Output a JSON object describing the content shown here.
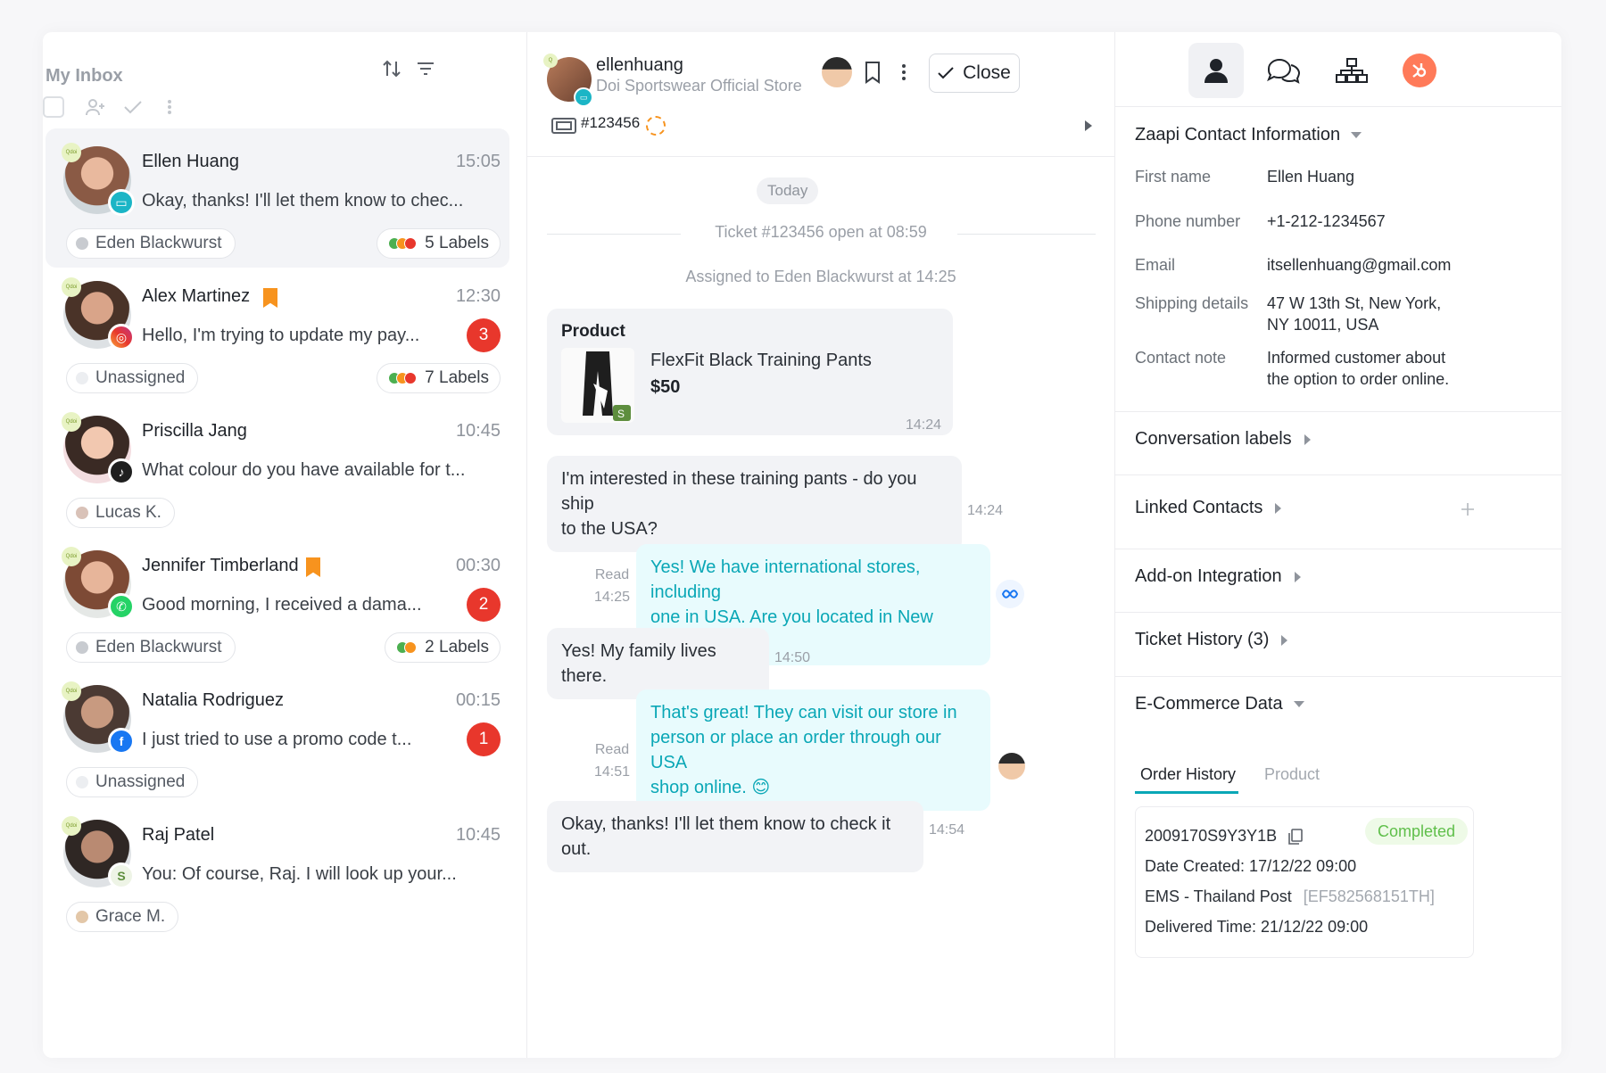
{
  "inbox": {
    "title": "My Inbox",
    "conversations": [
      {
        "name": "Ellen Huang",
        "time": "15:05",
        "message": "Okay, thanks! I'll let them know to chec...",
        "assignee": "Eden Blackwurst",
        "labels": "5 Labels",
        "channel": "chat",
        "unread": ""
      },
      {
        "name": "Alex Martinez",
        "time": "12:30",
        "message": "Hello, I'm trying to update my pay...",
        "assignee": "Unassigned",
        "labels": "7 Labels",
        "channel": "instagram",
        "unread": "3"
      },
      {
        "name": "Priscilla Jang",
        "time": "10:45",
        "message": "What colour do you have available for t...",
        "assignee": "Lucas K.",
        "labels": "",
        "channel": "tiktok",
        "unread": ""
      },
      {
        "name": "Jennifer Timberland",
        "time": "00:30",
        "message": "Good morning, I received a dama...",
        "assignee": "Eden Blackwurst",
        "labels": "2 Labels",
        "channel": "whatsapp",
        "unread": "2"
      },
      {
        "name": "Natalia Rodriguez",
        "time": "00:15",
        "message": "I just tried to use a promo code t...",
        "assignee": "Unassigned",
        "labels": "",
        "channel": "facebook",
        "unread": "1"
      },
      {
        "name": "Raj Patel",
        "time": "10:45",
        "message": "You: Of course, Raj. I will look up your...",
        "assignee": "Grace M.",
        "labels": "",
        "channel": "shopify",
        "unread": ""
      }
    ]
  },
  "chat": {
    "header": {
      "username": "ellenhuang",
      "store": "Doi Sportswear Official Store",
      "close_label": "Close",
      "ticket": "#123456"
    },
    "day": "Today",
    "system": [
      "Ticket #123456 open at 08:59",
      "Assigned to Eden Blackwurst at 14:25"
    ],
    "product": {
      "title": "Product",
      "name": "FlexFit Black Training Pants",
      "price": "$50",
      "time": "14:24"
    },
    "messages": [
      {
        "text1": "I'm interested in these training pants - do you ship",
        "text2": "to the USA?",
        "time": "14:24"
      },
      {
        "text1": "Yes! We have international stores, including",
        "text2": "one in USA. Are you located in New york?",
        "read": "Read",
        "time": "14:25"
      },
      {
        "text1": "Yes! My family lives there.",
        "time": "14:50"
      },
      {
        "text1": "That's great! They can visit our store in",
        "text2": "person or place an order through our USA",
        "text3": "shop online. 😊",
        "read": "Read",
        "time": "14:51"
      },
      {
        "text1": "Okay, thanks! I'll let them know to check it out.",
        "time": "14:54"
      }
    ]
  },
  "info": {
    "contact_section": "Zaapi Contact Information",
    "fields": [
      {
        "label": "First name",
        "value": "Ellen Huang"
      },
      {
        "label": "Phone number",
        "value": "+1-212-1234567"
      },
      {
        "label": "Email",
        "value": "itsellenhuang@gmail.com"
      },
      {
        "label": "Shipping details",
        "value": "47 W 13th St, New York,",
        "value2": "NY 10011, USA"
      },
      {
        "label": "Contact note",
        "value": "Informed customer about",
        "value2": "the option to order online."
      }
    ],
    "sections": [
      "Conversation labels",
      "Linked Contacts",
      "Add-on Integration",
      "Ticket History (3)"
    ],
    "ecommerce": {
      "title": "E-Commerce Data",
      "tabs": [
        "Order History",
        "Product"
      ],
      "order": {
        "id": "2009170S9Y3Y1B",
        "status": "Completed",
        "created": "Date Created: 17/12/22 09:00",
        "carrier": "EMS - Thailand Post",
        "tracking": "[EF582568151TH]",
        "delivered": "Delivered Time: 21/12/22 09:00"
      }
    },
    "colors": {
      "accent": "#0aa7b6",
      "unread": "#e8372c",
      "hubspot": "#ff7a59",
      "bookmark": "#f7931e"
    }
  }
}
